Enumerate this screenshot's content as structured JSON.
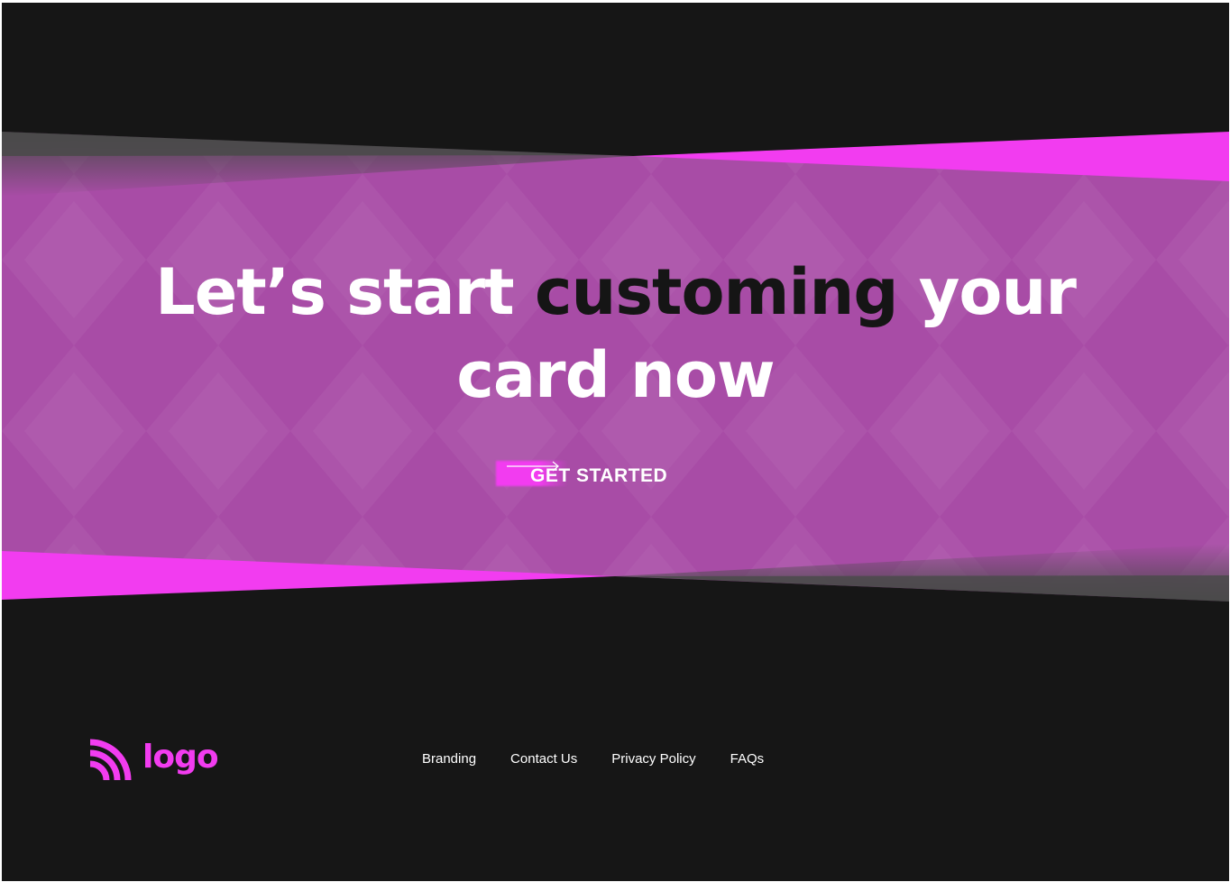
{
  "hero": {
    "headline_part1": "Let’s start ",
    "headline_highlight": "customing",
    "headline_part2": " your",
    "headline_line2": "card now",
    "cta_label": "GET STARTED"
  },
  "footer": {
    "logo_text": "logo",
    "nav": [
      {
        "label": "Branding"
      },
      {
        "label": "Contact Us"
      },
      {
        "label": "Privacy Policy"
      },
      {
        "label": "FAQs"
      }
    ]
  },
  "colors": {
    "background": "#161616",
    "band": "#a84ca6",
    "accent": "#f23cf0",
    "gray_band": "#4a4a4a"
  },
  "icons": {
    "logo": "signal-arcs-icon",
    "cta_arrow": "long-arrow-right-icon"
  }
}
